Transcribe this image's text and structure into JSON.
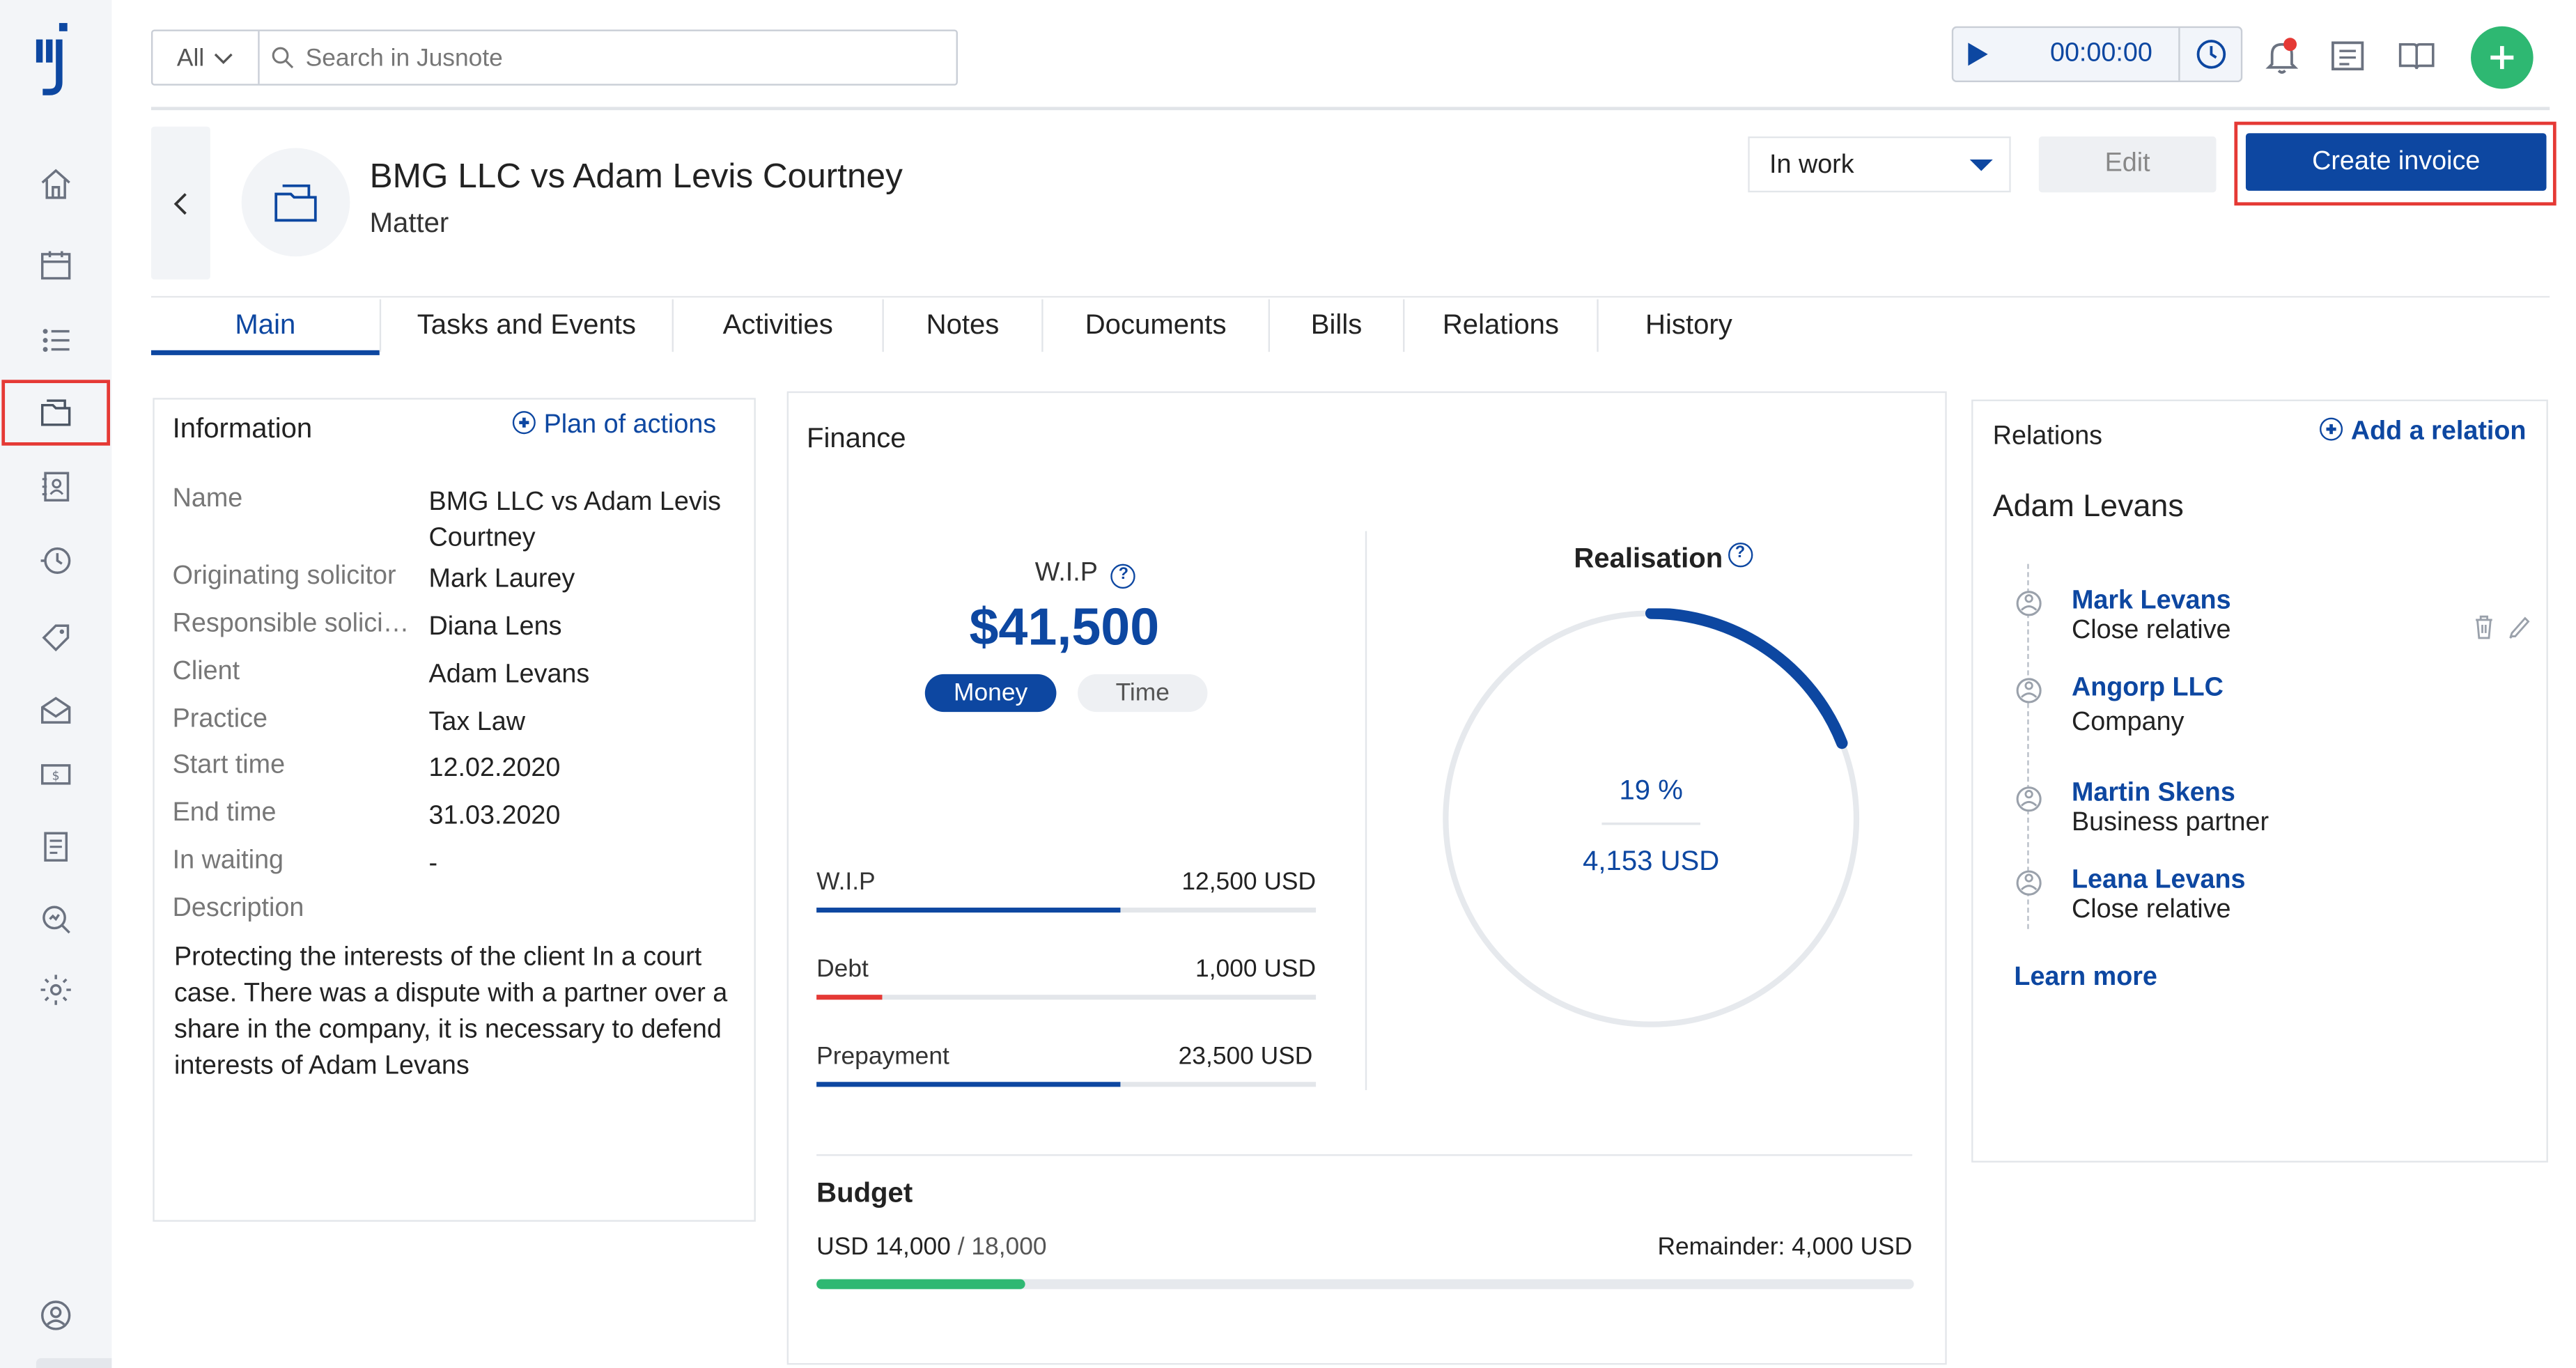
{
  "search": {
    "scope": "All",
    "placeholder": "Search in Jusnote"
  },
  "timer": {
    "time": "00:00:00"
  },
  "matter": {
    "title": "BMG LLC vs Adam Levis Courtney",
    "subtitle": "Matter"
  },
  "actions": {
    "status": "In work",
    "edit": "Edit",
    "create_invoice": "Create invoice"
  },
  "tabs": [
    "Main",
    "Tasks and Events",
    "Activities",
    "Notes",
    "Documents",
    "Bills",
    "Relations",
    "History"
  ],
  "information": {
    "title": "Information",
    "plan_link": "Plan of actions",
    "rows": [
      {
        "label": "Name",
        "value": "BMG LLC vs Adam Levis Courtney"
      },
      {
        "label": "Originating solicitor",
        "value": "Mark Laurey"
      },
      {
        "label": "Responsible solicitor",
        "value": "Diana Lens"
      },
      {
        "label": "Client",
        "value": "Adam Levans"
      },
      {
        "label": "Practice",
        "value": "Tax Law"
      },
      {
        "label": "Start time",
        "value": "12.02.2020"
      },
      {
        "label": "End time",
        "value": "31.03.2020"
      },
      {
        "label": "In waiting",
        "value": "-"
      }
    ],
    "description_label": "Description",
    "description": "Protecting the interests of the client In a court case. There was a dispute with a partner over a share in the company, it is necessary to defend interests of Adam Levans"
  },
  "finance": {
    "title": "Finance",
    "wip_label": "W.I.P",
    "wip_amount": "$41,500",
    "toggle_money": "Money",
    "toggle_time": "Time",
    "rows": [
      {
        "label": "W.I.P",
        "value": "12,500 USD",
        "fill": 0.61,
        "color": "#0d47a1"
      },
      {
        "label": "Debt",
        "value": "1,000 USD",
        "fill": 0.13,
        "color": "#e53935"
      },
      {
        "label": "Prepayment",
        "value": "23,500 USD",
        "fill": 0.61,
        "color": "#0d47a1"
      }
    ],
    "realisation_title": "Realisation",
    "realisation_percent": "19 %",
    "realisation_fraction": 0.19,
    "realisation_amount": "4,153 USD",
    "budget_title": "Budget",
    "budget_spent": "USD 14,000",
    "budget_total": "/ 18,000",
    "budget_remainder": "Remainder: 4,000 USD",
    "budget_fraction": 0.19
  },
  "relations": {
    "title": "Relations",
    "add_link": "Add a relation",
    "person": "Adam Levans",
    "items": [
      {
        "name": "Mark Levans",
        "type": "Close relative"
      },
      {
        "name": "Angorp LLC",
        "type": "Company"
      },
      {
        "name": "Martin Skens",
        "type": "Business partner"
      },
      {
        "name": "Leana Levans",
        "type": "Close relative"
      }
    ],
    "learn_more": "Learn more"
  },
  "colors": {
    "primary": "#0d47a1",
    "accent_green": "#2eb872",
    "alert_red": "#e53935"
  }
}
